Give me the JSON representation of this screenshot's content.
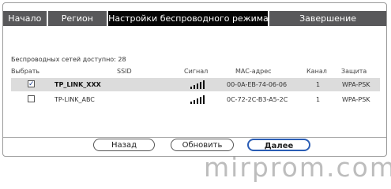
{
  "tabs": [
    {
      "label": "Начало",
      "active": false
    },
    {
      "label": "Регион",
      "active": false
    },
    {
      "label": "Настройки беспроводного режима",
      "active": true
    },
    {
      "label": "Завершение",
      "active": false
    }
  ],
  "networks_count": "Беспроводных сетей доступно: 28",
  "table": {
    "headers": {
      "select": "Выбрать",
      "ssid": "SSID",
      "signal": "Сигнал",
      "mac": "MAC-адрес",
      "channel": "Канал",
      "security": "Защита"
    },
    "rows": [
      {
        "selected": true,
        "check": "✓",
        "ssid": "TP_LINK_XXX",
        "signal_bars": 5,
        "mac": "00-0A-EB-74-06-06",
        "channel": "1",
        "security": "WPA-PSK"
      },
      {
        "selected": false,
        "check": "",
        "ssid": "TP-LINK_ABC",
        "signal_bars": 5,
        "mac": "0C-72-2C-B3-A5-2C",
        "channel": "1",
        "security": "WPA-PSK"
      }
    ]
  },
  "buttons": {
    "back": "Назад",
    "refresh": "Обновить",
    "next": "Далее"
  },
  "watermark": "mirprom.com",
  "colors": {
    "tab_bar": "#58585a",
    "tab_active": "#050505",
    "selected_row": "#dcdcdc",
    "primary_button_border": "#2a5db5",
    "check_mark": "#1a3d8f"
  }
}
